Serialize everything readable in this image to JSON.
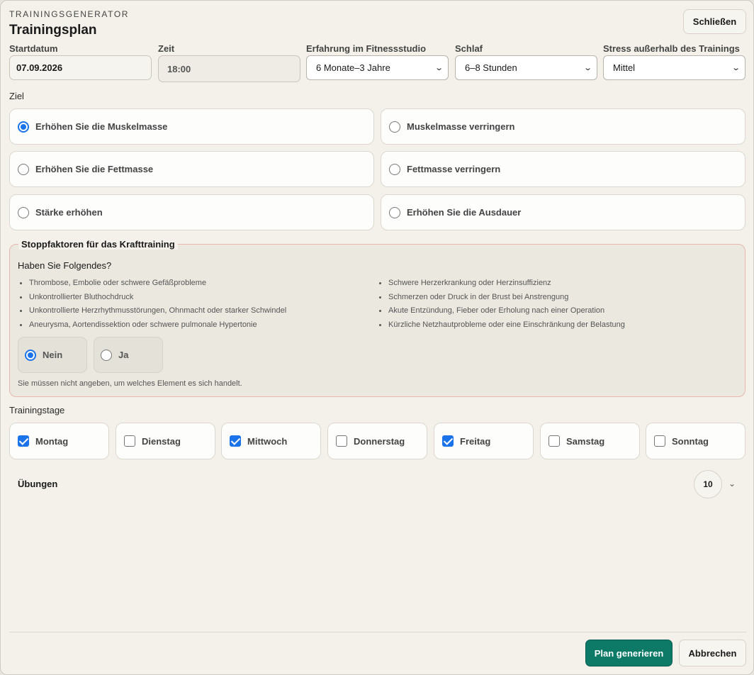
{
  "header": {
    "eyebrow": "TRAININGSGENERATOR",
    "title": "Trainingsplan",
    "close_label": "Schließen"
  },
  "fields": {
    "start_date": {
      "label": "Startdatum",
      "value": "07.09.2026"
    },
    "time": {
      "label": "Zeit",
      "value": "18:00"
    },
    "experience": {
      "label": "Erfahrung im Fitnessstudio",
      "value": "6 Monate–3 Jahre"
    },
    "sleep": {
      "label": "Schlaf",
      "value": "6–8 Stunden"
    },
    "stress": {
      "label": "Stress außerhalb des Trainings",
      "value": "Mittel"
    }
  },
  "goal": {
    "label": "Ziel",
    "selected": "Erhöhen Sie die Muskelmasse",
    "options": [
      "Erhöhen Sie die Muskelmasse",
      "Muskelmasse verringern",
      "Erhöhen Sie die Fettmasse",
      "Fettmasse verringern",
      "Stärke erhöhen",
      "Erhöhen Sie die Ausdauer"
    ]
  },
  "stop_factors": {
    "legend": "Stoppfaktoren für das Krafttraining",
    "question": "Haben Sie Folgendes?",
    "left_items": [
      "Thrombose, Embolie oder schwere Gefäßprobleme",
      "Unkontrollierter Bluthochdruck",
      "Unkontrollierte Herzrhythmusstörungen, Ohnmacht oder starker Schwindel",
      "Aneurysma, Aortendissektion oder schwere pulmonale Hypertonie"
    ],
    "right_items": [
      "Schwere Herzerkrankung oder Herzinsuffizienz",
      "Schmerzen oder Druck in der Brust bei Anstrengung",
      "Akute Entzündung, Fieber oder Erholung nach einer Operation",
      "Kürzliche Netzhautprobleme oder eine Einschränkung der Belastung"
    ],
    "no_label": "Nein",
    "yes_label": "Ja",
    "selected": "Nein",
    "note": "Sie müssen nicht angeben, um welches Element es sich handelt."
  },
  "training_days": {
    "label": "Trainingstage",
    "days": [
      {
        "label": "Montag",
        "checked": true
      },
      {
        "label": "Dienstag",
        "checked": false
      },
      {
        "label": "Mittwoch",
        "checked": true
      },
      {
        "label": "Donnerstag",
        "checked": false
      },
      {
        "label": "Freitag",
        "checked": true
      },
      {
        "label": "Samstag",
        "checked": false
      },
      {
        "label": "Sonntag",
        "checked": false
      }
    ]
  },
  "exercises": {
    "label": "Übungen",
    "count": "10"
  },
  "footer": {
    "generate_label": "Plan generieren",
    "cancel_label": "Abbrechen"
  },
  "colors": {
    "accent": "#0d7a68",
    "selection": "#1a73e8",
    "warning_border": "#e6b8ad"
  },
  "icons": {
    "select_caret": "chevron-down-icon",
    "expand": "chevron-down-icon"
  }
}
